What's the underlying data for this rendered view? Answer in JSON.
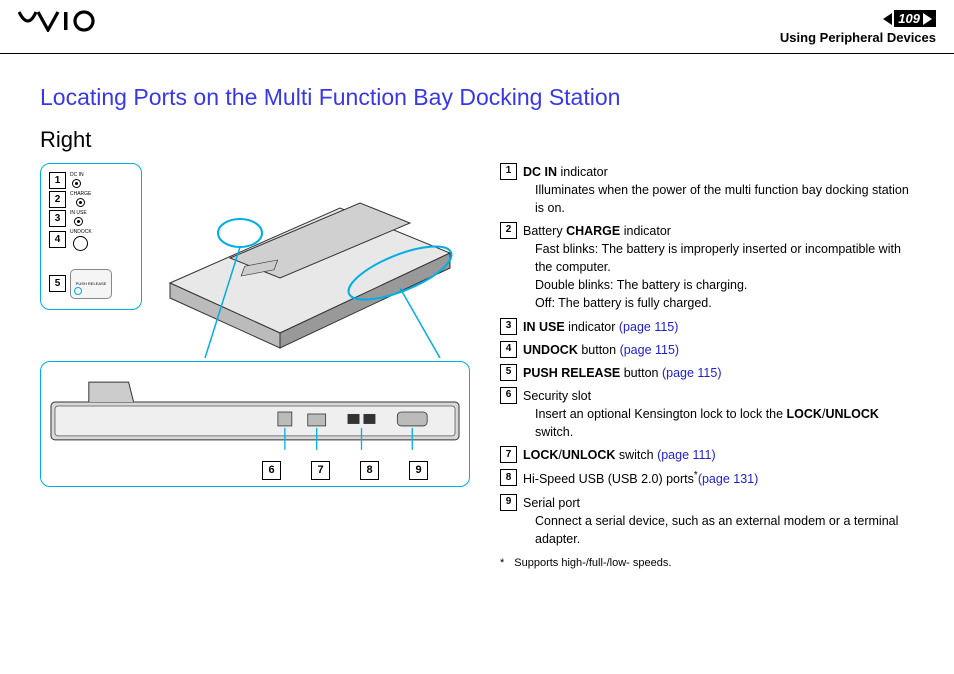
{
  "header": {
    "page_number": "109",
    "breadcrumb": "Using Peripheral Devices"
  },
  "title": "Locating Ports on the Multi Function Bay Docking Station",
  "subtitle": "Right",
  "indicators": {
    "dc_in_label": "DC IN",
    "charge_label": "CHARGE",
    "in_use_label": "IN USE",
    "undock_label": "UNDOCK",
    "push_release_label": "PUSH RELEASE"
  },
  "legend": [
    {
      "num": "1",
      "bold1": "DC IN",
      "text1": " indicator",
      "detail": "Illuminates when the power of the multi function bay docking station is on."
    },
    {
      "num": "2",
      "text_pre": "Battery ",
      "bold1": "CHARGE",
      "text1": " indicator",
      "detail": "Fast blinks: The battery is improperly inserted or incompatible with the computer.",
      "detail2": "Double blinks: The battery is charging.",
      "detail3": "Off: The battery is fully charged."
    },
    {
      "num": "3",
      "bold1": "IN USE",
      "text1": " indicator ",
      "link": "(page 115)"
    },
    {
      "num": "4",
      "bold1": "UNDOCK",
      "text1": " button ",
      "link": "(page 115)"
    },
    {
      "num": "5",
      "bold1": "PUSH RELEASE",
      "text1": " button ",
      "link": "(page 115)"
    },
    {
      "num": "6",
      "text1": "Security slot",
      "detail": "Insert an optional Kensington lock to lock the ",
      "detail_bold": "LOCK",
      "detail_mid": "/",
      "detail_bold2": "UNLOCK",
      "detail_end": " switch."
    },
    {
      "num": "7",
      "bold1": "LOCK",
      "mid": "/",
      "bold2": "UNLOCK",
      "text1": " switch ",
      "link": "(page 111)"
    },
    {
      "num": "8",
      "text1": "Hi-Speed USB (USB 2.0) ports",
      "ast": "*",
      "link": "(page 131)"
    },
    {
      "num": "9",
      "text1": "Serial port",
      "detail": "Connect a serial device, such as an external modem or a terminal adapter."
    }
  ],
  "footnote": {
    "mark": "*",
    "text": "Supports high-/full-/low- speeds."
  },
  "side_numbers": [
    "6",
    "7",
    "8",
    "9"
  ]
}
